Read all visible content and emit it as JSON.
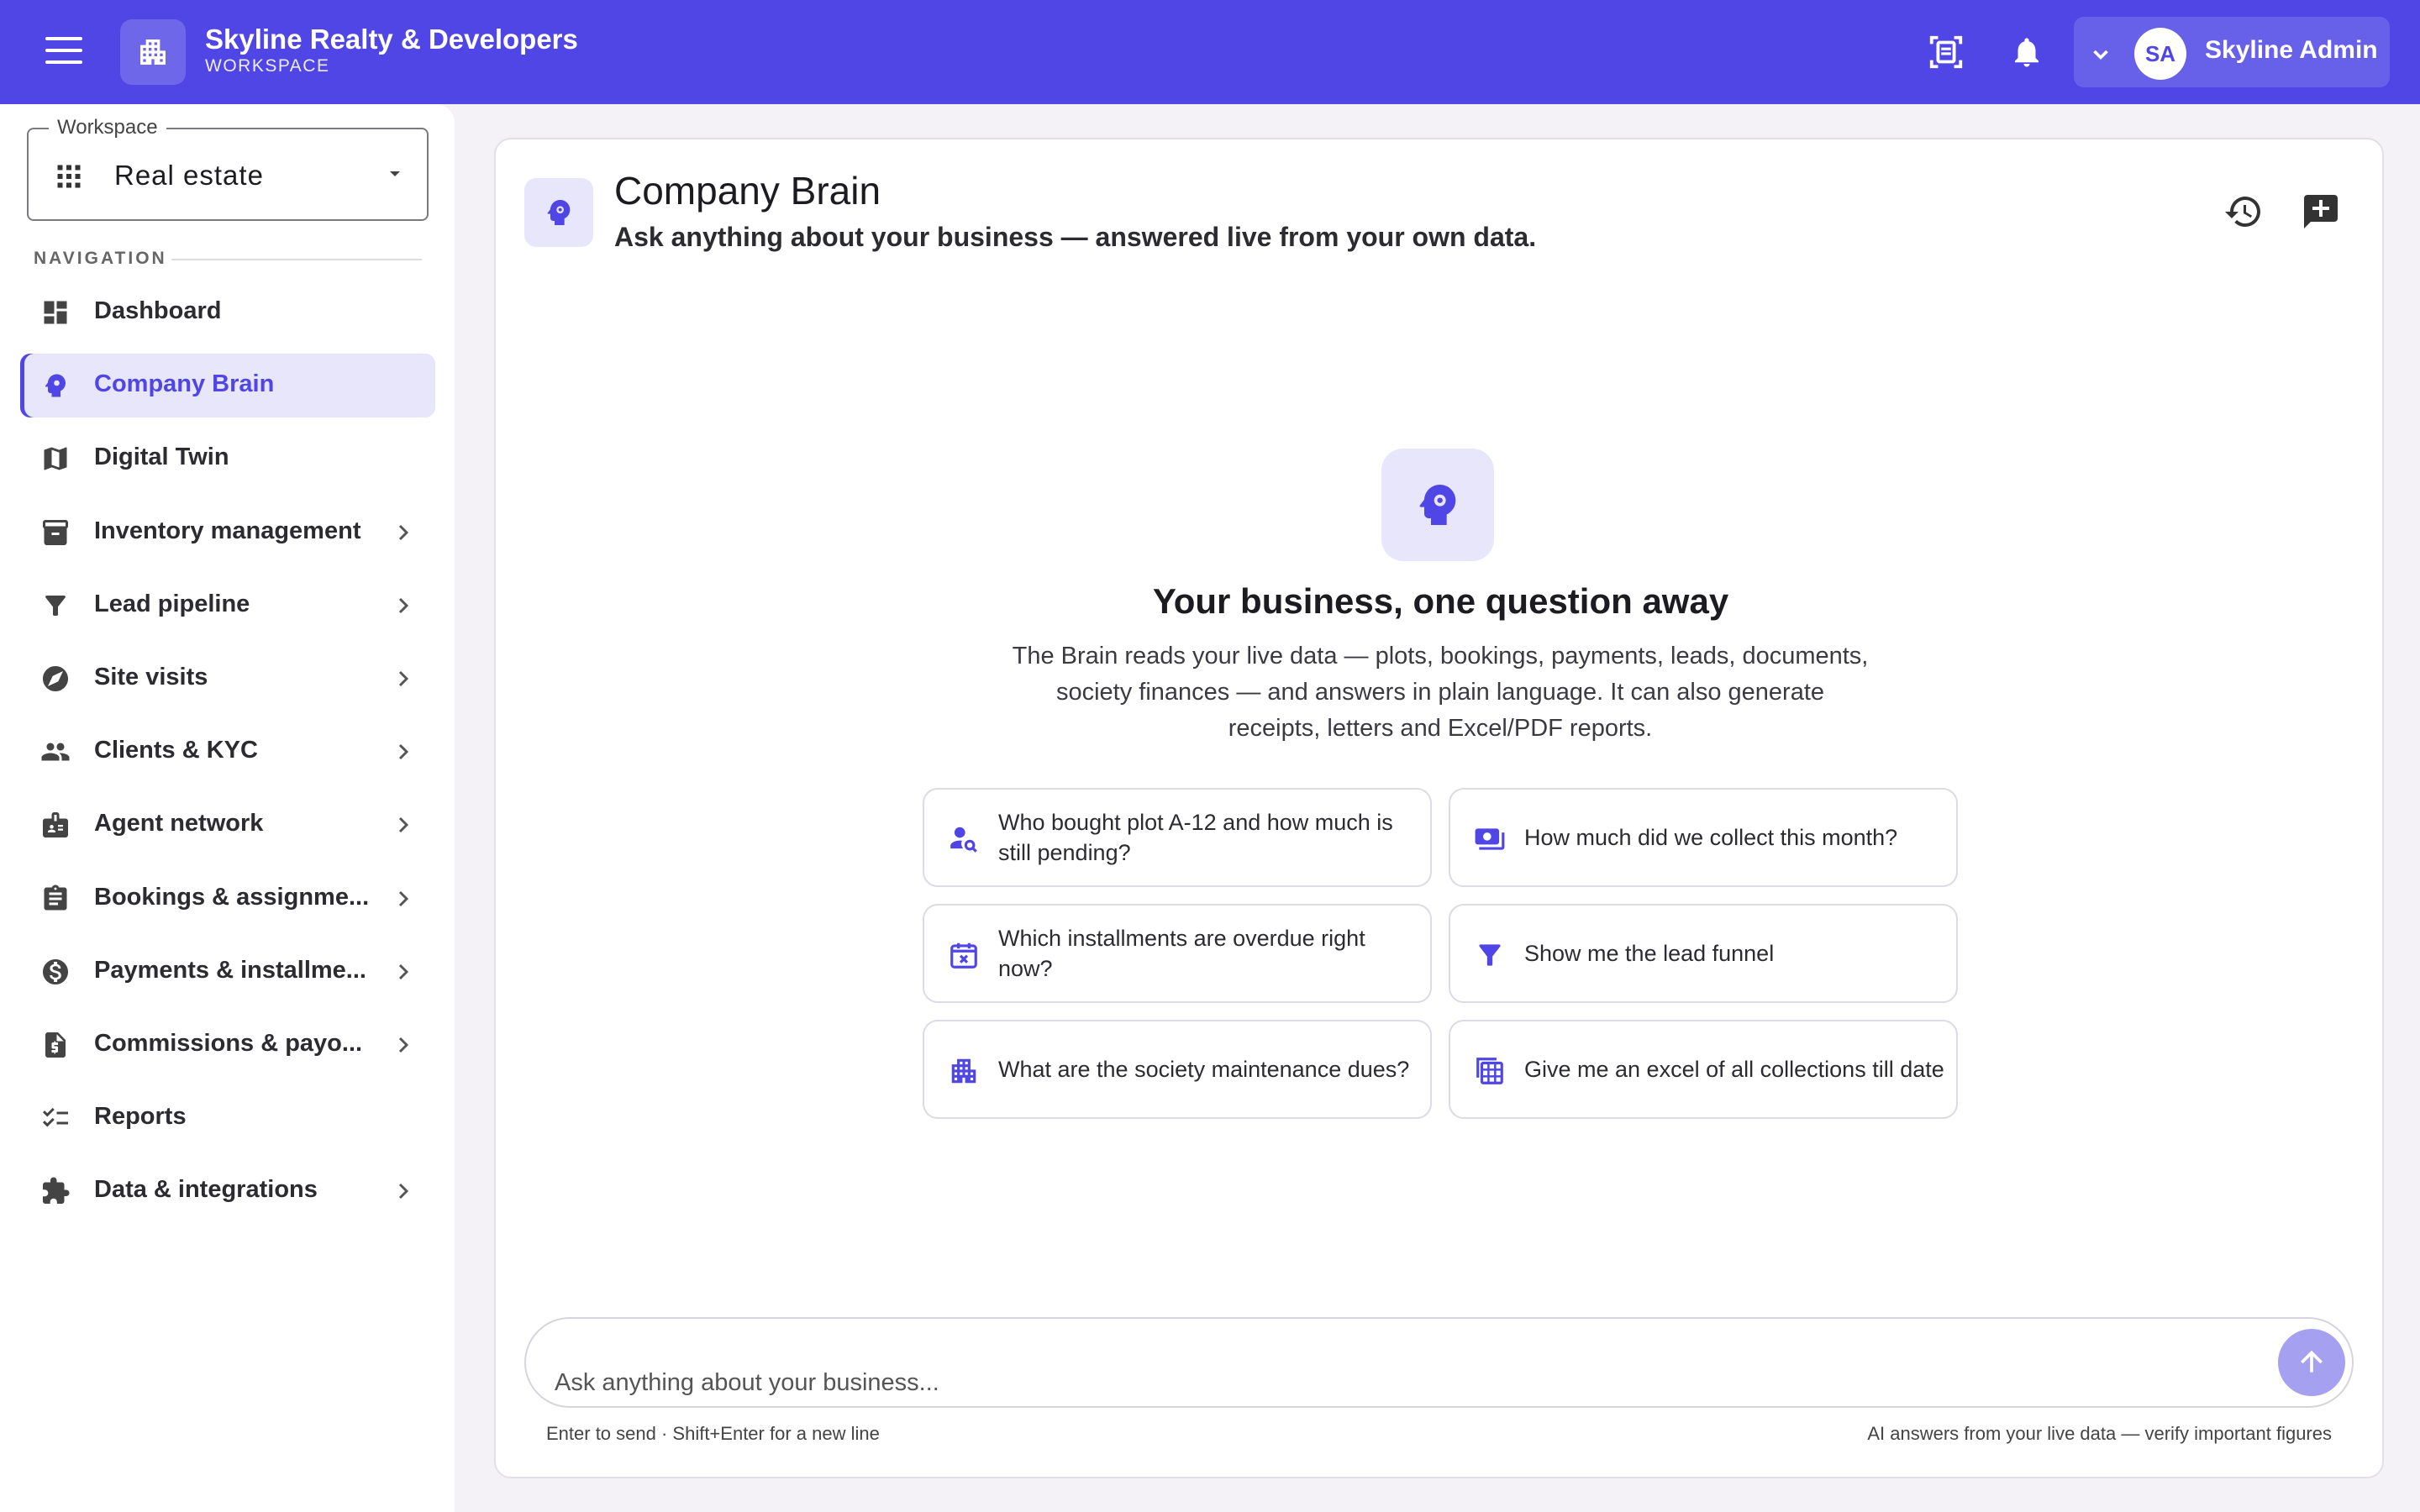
{
  "topbar": {
    "brand_name": "Skyline Realty & Developers",
    "brand_sub": "WORKSPACE",
    "user_initials": "SA",
    "user_name": "Skyline Admin",
    "accent": "#4f46e5"
  },
  "sidebar": {
    "workspace_label": "Workspace",
    "workspace_value": "Real estate",
    "nav_heading": "NAVIGATION",
    "items": [
      {
        "label": "Dashboard",
        "icon": "dashboard-icon",
        "active": false,
        "has_children": false
      },
      {
        "label": "Company Brain",
        "icon": "brain-icon",
        "active": true,
        "has_children": false
      },
      {
        "label": "Digital Twin",
        "icon": "map-icon",
        "active": false,
        "has_children": false
      },
      {
        "label": "Inventory management",
        "icon": "archive-icon",
        "active": false,
        "has_children": true
      },
      {
        "label": "Lead pipeline",
        "icon": "funnel-icon",
        "active": false,
        "has_children": true
      },
      {
        "label": "Site visits",
        "icon": "compass-icon",
        "active": false,
        "has_children": true
      },
      {
        "label": "Clients & KYC",
        "icon": "people-icon",
        "active": false,
        "has_children": true
      },
      {
        "label": "Agent network",
        "icon": "badge-icon",
        "active": false,
        "has_children": true
      },
      {
        "label": "Bookings & assignme...",
        "icon": "clipboard-icon",
        "active": false,
        "has_children": true
      },
      {
        "label": "Payments & installme...",
        "icon": "dollar-icon",
        "active": false,
        "has_children": true
      },
      {
        "label": "Commissions & payo...",
        "icon": "invoice-icon",
        "active": false,
        "has_children": true
      },
      {
        "label": "Reports",
        "icon": "checklist-icon",
        "active": false,
        "has_children": false
      },
      {
        "label": "Data & integrations",
        "icon": "puzzle-icon",
        "active": false,
        "has_children": true
      }
    ]
  },
  "main": {
    "title": "Company Brain",
    "subtitle": "Ask anything about your business — answered live from your own data.",
    "hero_title": "Your business, one question away",
    "hero_desc": "The Brain reads your live data — plots, bookings, payments, leads, documents, society finances — and answers in plain language. It can also generate receipts, letters and Excel/PDF reports.",
    "suggestions": [
      {
        "text": "Who bought plot A-12 and how much is still pending?",
        "icon": "person-search-icon"
      },
      {
        "text": "How much did we collect this month?",
        "icon": "cash-icon"
      },
      {
        "text": "Which installments are overdue right now?",
        "icon": "calendar-x-icon"
      },
      {
        "text": "Show me the lead funnel",
        "icon": "funnel-icon"
      },
      {
        "text": "What are the society maintenance dues?",
        "icon": "building-icon"
      },
      {
        "text": "Give me an excel of all collections till date",
        "icon": "spreadsheet-icon"
      }
    ],
    "composer": {
      "placeholder": "Ask anything about your business...",
      "hint_left": "Enter to send · Shift+Enter for a new line",
      "hint_right": "AI answers from your live data — verify important figures"
    }
  }
}
